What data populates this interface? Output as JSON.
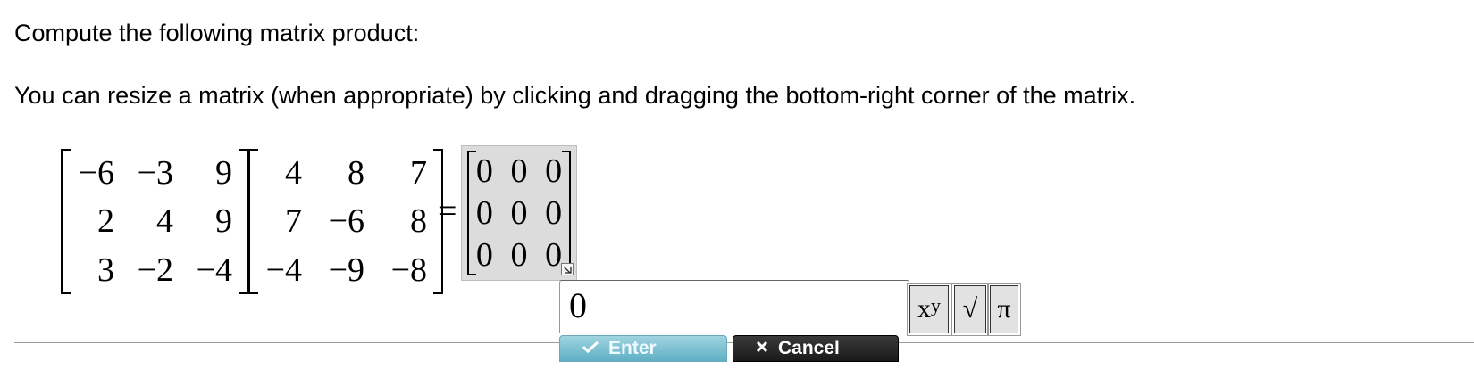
{
  "question": {
    "title": "Compute the following matrix product:",
    "instruction": "You can resize a matrix (when appropriate) by clicking and dragging the bottom-right corner of the matrix."
  },
  "matrix_a": [
    [
      "−6",
      "−3",
      "9"
    ],
    [
      "2",
      "4",
      "9"
    ],
    [
      "3",
      "−2",
      "−4"
    ]
  ],
  "matrix_b": [
    [
      "4",
      "8",
      "7"
    ],
    [
      "7",
      "−6",
      "8"
    ],
    [
      "−4",
      "−9",
      "−8"
    ]
  ],
  "equals_sign": "=",
  "answer_matrix": [
    [
      "0",
      "0",
      "0"
    ],
    [
      "0",
      "0",
      "0"
    ],
    [
      "0",
      "0",
      "0"
    ]
  ],
  "entry": {
    "value": "0"
  },
  "toolbar": {
    "power_base": "x",
    "power_exp": "y",
    "sqrt_label": "√",
    "pi_label": "π"
  },
  "actions": {
    "enter_label": "Enter",
    "cancel_label": "Cancel"
  },
  "icons": {
    "enter": "checkmark-icon",
    "cancel": "x-icon",
    "resize": "resize-corner-icon"
  },
  "colors": {
    "answer_bg": "#dcdcdc",
    "enter_button": "#5fb0c6",
    "cancel_button": "#1a1a1a"
  }
}
